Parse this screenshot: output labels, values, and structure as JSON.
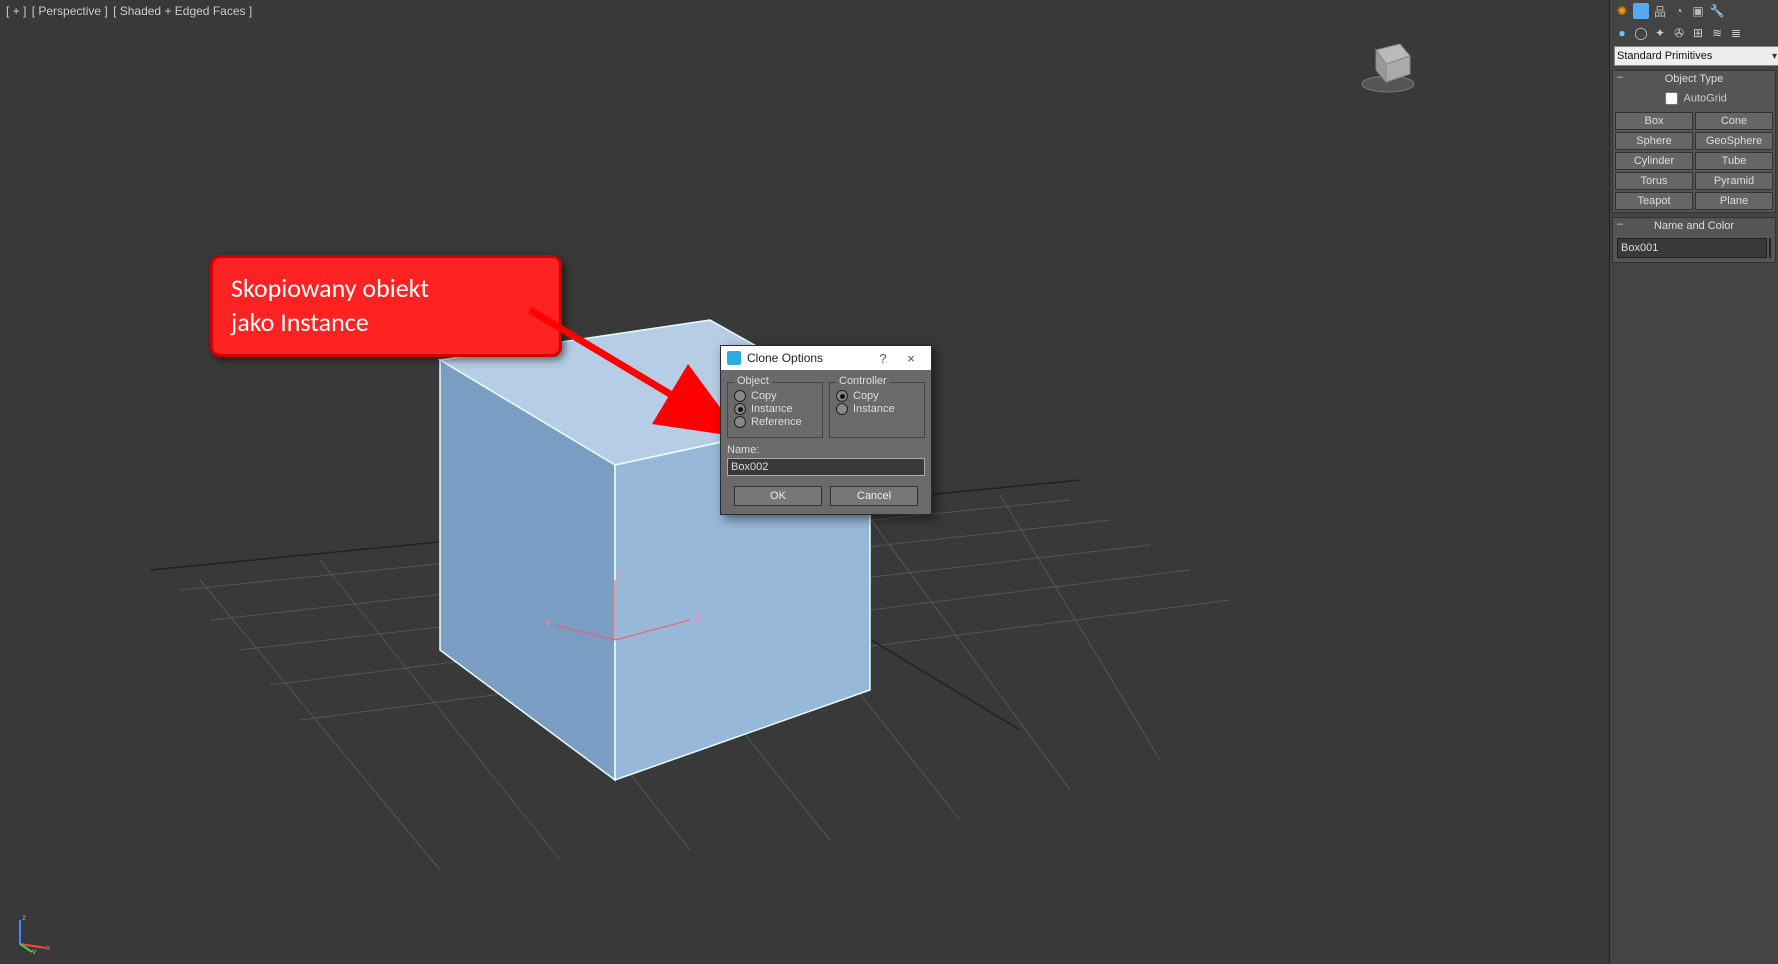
{
  "viewport": {
    "label_parts": [
      "[ + ]",
      "[ Perspective ]",
      "[ Shaded + Edged Faces ]"
    ],
    "cube_axes": {
      "x": "x",
      "y": "y",
      "z": "z"
    },
    "gizmo": {
      "x": "x",
      "y": "y",
      "z": "z"
    }
  },
  "callout": {
    "line1": "Skopiowany obiekt",
    "line2": "jako Instance"
  },
  "dialog": {
    "title": "Clone Options",
    "help_char": "?",
    "close_char": "×",
    "group_object": {
      "title": "Object",
      "opt_copy": "Copy",
      "opt_instance": "Instance",
      "opt_reference": "Reference",
      "selected": "instance"
    },
    "group_controller": {
      "title": "Controller",
      "opt_copy": "Copy",
      "opt_instance": "Instance",
      "selected": "copy"
    },
    "name_label": "Name:",
    "name_value": "Box002",
    "ok_label": "OK",
    "cancel_label": "Cancel"
  },
  "right_panel": {
    "toolbar1_icons": [
      "sun-icon",
      "create-icon",
      "hierarchy-icon",
      "motion-icon",
      "display-icon",
      "utilities-icon"
    ],
    "toolbar2_icons": [
      "geometry-icon",
      "shapes-icon",
      "lights-icon",
      "cameras-icon",
      "helpers-icon",
      "spacewarps-icon",
      "layers-icon"
    ],
    "dropdown_value": "Standard Primitives",
    "rollout_object_type": {
      "title": "Object Type",
      "autogrid_label": "AutoGrid",
      "buttons": [
        "Box",
        "Cone",
        "Sphere",
        "GeoSphere",
        "Cylinder",
        "Tube",
        "Torus",
        "Pyramid",
        "Teapot",
        "Plane"
      ]
    },
    "rollout_name_color": {
      "title": "Name and Color",
      "value": "Box001"
    }
  }
}
